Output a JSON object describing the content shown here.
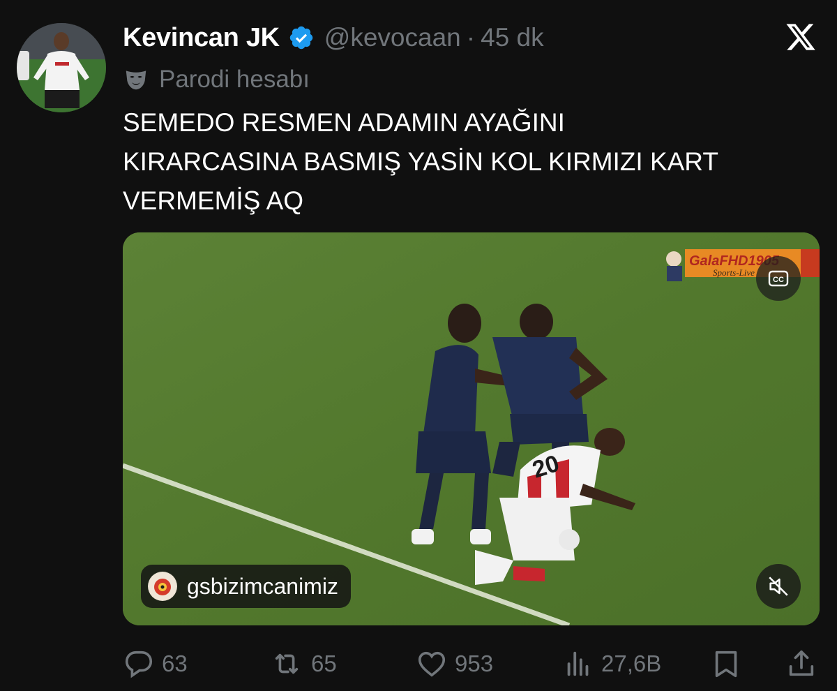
{
  "author": {
    "name": "Kevincan JK",
    "handle": "@kevocaan",
    "separator": "·",
    "time": "45 dk"
  },
  "parody_label": "Parodi hesabı",
  "tweet_text": "SEMEDO RESMEN ADAMIN AYAĞINI\nKIRARCASINA BASMIŞ YASİN KOL KIRMIZI KART\nVERMEMİŞ AQ",
  "media": {
    "watermark_brand": "GalaFHD1905",
    "watermark_sub": "Sports-Live",
    "source_handle": "gsbizimcanimiz",
    "player_number": "20"
  },
  "actions": {
    "replies": "63",
    "reposts": "65",
    "likes": "953",
    "views": "27,6B"
  },
  "colors": {
    "background": "#101010",
    "verified": "#1d9bf0",
    "muted_text": "#71767b",
    "pitch": "#557a2f"
  },
  "icons": [
    "x-logo-icon",
    "verified-icon",
    "parody-mask-icon",
    "cc-icon",
    "mute-icon",
    "reply-icon",
    "repost-icon",
    "like-icon",
    "views-icon",
    "bookmark-icon",
    "share-icon"
  ]
}
